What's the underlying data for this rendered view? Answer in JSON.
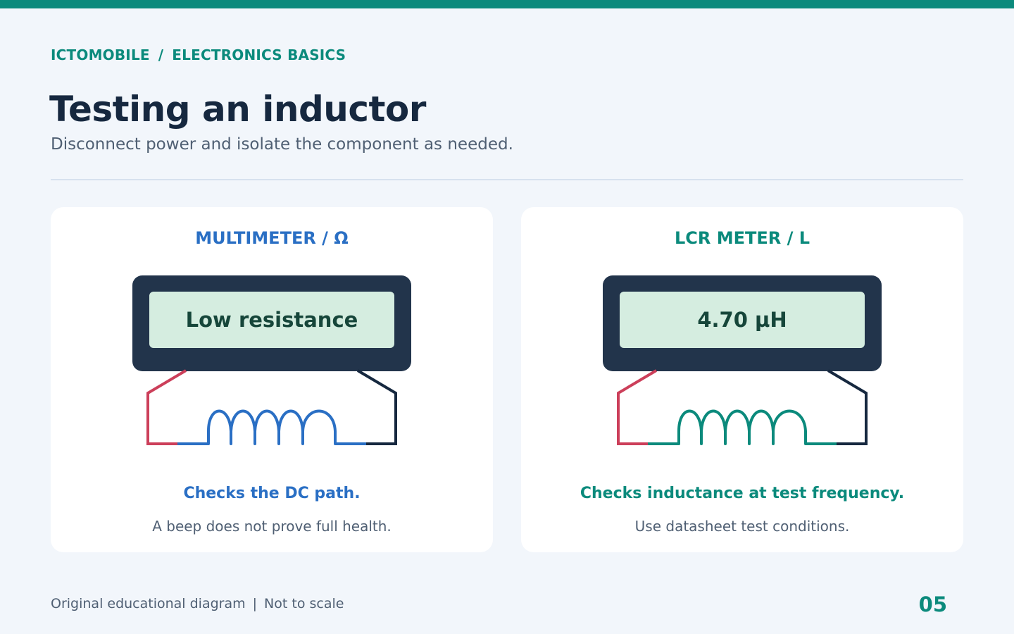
{
  "header": {
    "breadcrumb": [
      "ICTOMOBILE",
      "/",
      "ELECTRONICS BASICS"
    ],
    "title": "Testing an inductor",
    "subtitle": "Disconnect power and isolate the component as needed."
  },
  "panels": [
    {
      "title": "MULTIMETER / Ω",
      "display": "Low resistance",
      "caption": "Checks the DC path.",
      "note": "A beep does not prove full health.",
      "accent": "#2a6fc4"
    },
    {
      "title": "LCR METER / L",
      "display": "4.70 µH",
      "caption": "Checks inductance at test frequency.",
      "note": "Use datasheet test conditions.",
      "accent": "#0b8a7c"
    }
  ],
  "colors": {
    "top_bar": "#0b8a7c",
    "red_lead": "#cc3f5a",
    "black_lead": "#16283f",
    "meter_body": "#22344b",
    "screen": "#d5ede0"
  },
  "footer": {
    "note_parts": [
      "Original educational diagram",
      "|",
      "Not to scale"
    ],
    "page_number": "05"
  }
}
